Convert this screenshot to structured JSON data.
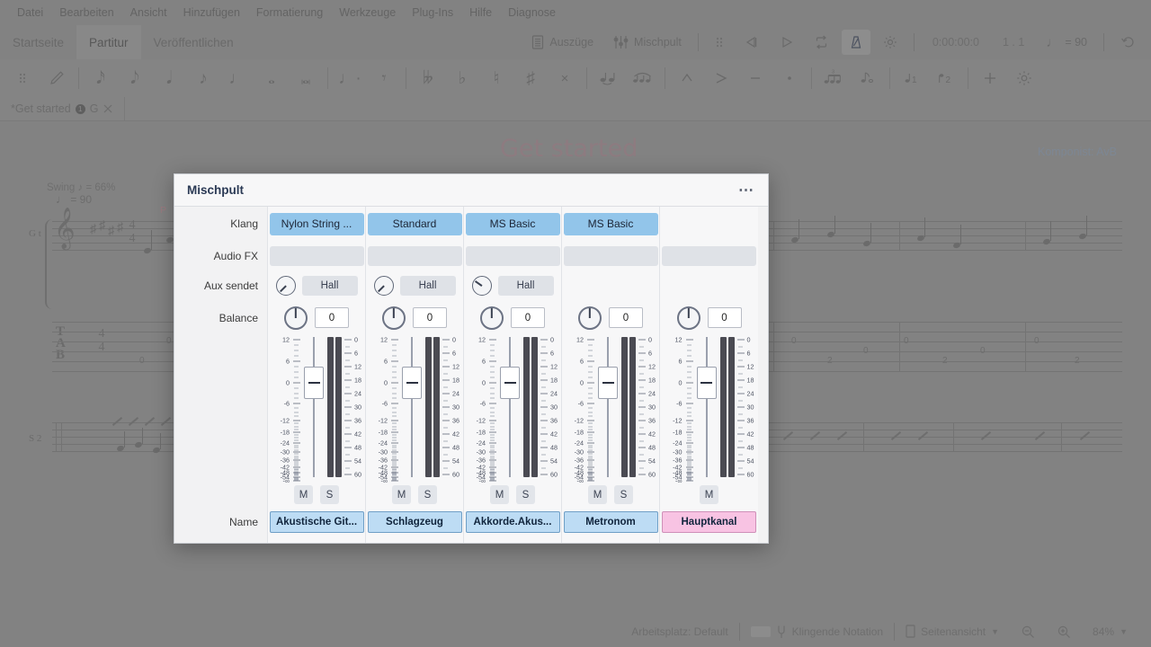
{
  "menubar": {
    "items": [
      "Datei",
      "Bearbeiten",
      "Ansicht",
      "Hinzufügen",
      "Formatierung",
      "Werkzeuge",
      "Plug-Ins",
      "Hilfe",
      "Diagnose"
    ]
  },
  "ribbon": {
    "tabs": [
      {
        "label": "Startseite",
        "active": false
      },
      {
        "label": "Partitur",
        "active": true
      },
      {
        "label": "Veröffentlichen",
        "active": false
      }
    ],
    "parts_button": "Auszüge",
    "mixer_button": "Mischpult",
    "transport": {
      "grip_icon": "drag-grip-icon",
      "rewind_icon": "rewind-icon",
      "play_icon": "play-icon",
      "loop_icon": "loop-icon",
      "metronome_icon": "metronome-icon",
      "metronome_active": true,
      "settings_icon": "gear-icon",
      "timecode": "0:00:00:0",
      "position": "1 . 1",
      "tempo": "= 90",
      "tempo_note_icon": "quarter-note-icon",
      "undo_icon": "undo-icon"
    }
  },
  "notation_toolbar": {
    "grip_icon": "drag-grip-icon",
    "groups": [
      [
        "pencil-icon"
      ],
      [
        "note-32nd-icon",
        "note-32nd-b-icon",
        "note-16th-icon",
        "note-8th-icon",
        "note-quarter-icon",
        "note-half-icon",
        "note-whole-icon"
      ],
      [
        "dotted-note-icon",
        "rest-icon"
      ],
      [
        "double-flat-icon",
        "flat-icon",
        "natural-icon",
        "sharp-icon",
        "double-sharp-icon"
      ],
      [
        "tie-icon",
        "slur-icon"
      ],
      [
        "marcato-icon",
        "accent-icon",
        "tenuto-icon",
        "staccato-icon"
      ],
      [
        "triplet-icon",
        "grace-note-icon"
      ],
      [
        "voice-1-icon",
        "voice-2-icon"
      ],
      [
        "add-icon",
        "gear-icon"
      ]
    ]
  },
  "document_tab": {
    "title": "*Get started",
    "badge": "1",
    "key": "G",
    "close_icon": "close-icon"
  },
  "score": {
    "title": "Get started",
    "composer": "Komponist: AvB",
    "swing_text": "Swing ♪ = 66%",
    "tempo_text": "= 90",
    "time_signature_top": "4",
    "time_signature_bottom": "4",
    "tab_letters": [
      "T",
      "A",
      "B"
    ],
    "system_labels": [
      "G t",
      "S 2"
    ]
  },
  "dialog": {
    "title": "Mischpult",
    "overflow_icon": "more-options-icon",
    "row_labels": {
      "klang": "Klang",
      "audio_fx": "Audio FX",
      "aux_send": "Aux sendet",
      "balance": "Balance",
      "name": "Name"
    },
    "mute_label": "M",
    "solo_label": "S",
    "fader_scale_left": [
      "12",
      "6",
      "0",
      "-6",
      "-12",
      "-18",
      "-24",
      "-30",
      "-36",
      "-42",
      "-48",
      "-54",
      "-∞"
    ],
    "meter_scale_right": [
      "0",
      "6",
      "12",
      "18",
      "24",
      "30",
      "36",
      "42",
      "48",
      "54",
      "60"
    ],
    "channels": [
      {
        "name": "Akustische Git...",
        "sound": "Nylon String ...",
        "audio_fx": "",
        "aux_send_label": "Hall",
        "aux_knob_angle": 225,
        "has_aux": true,
        "balance": "0",
        "balance_knob_angle": 0,
        "fader_db": "0",
        "has_solo": true,
        "is_master": false
      },
      {
        "name": "Schlagzeug",
        "sound": "Standard",
        "audio_fx": "",
        "aux_send_label": "Hall",
        "aux_knob_angle": 225,
        "has_aux": true,
        "balance": "0",
        "balance_knob_angle": 0,
        "fader_db": "0",
        "has_solo": true,
        "is_master": false
      },
      {
        "name": "Akkorde.Akus...",
        "sound": "MS Basic",
        "audio_fx": "",
        "aux_send_label": "Hall",
        "aux_knob_angle": 305,
        "has_aux": true,
        "balance": "0",
        "balance_knob_angle": 0,
        "fader_db": "0",
        "has_solo": true,
        "is_master": false
      },
      {
        "name": "Metronom",
        "sound": "MS Basic",
        "audio_fx": "",
        "aux_send_label": "",
        "aux_knob_angle": 0,
        "has_aux": false,
        "balance": "0",
        "balance_knob_angle": 0,
        "fader_db": "0",
        "has_solo": true,
        "is_master": false
      },
      {
        "name": "Hauptkanal",
        "sound": "",
        "audio_fx": "",
        "aux_send_label": "",
        "aux_knob_angle": 0,
        "has_aux": false,
        "balance": "0",
        "balance_knob_angle": 0,
        "fader_db": "0",
        "has_solo": false,
        "is_master": true
      }
    ]
  },
  "statusbar": {
    "workspace": "Arbeitsplatz: Default",
    "concert_pitch": "Klingende Notation",
    "concert_pitch_icon": "tuning-fork-icon",
    "view_mode": "Seitenansicht",
    "view_mode_icon": "page-icon",
    "zoom_out_icon": "zoom-out-icon",
    "zoom_in_icon": "zoom-in-icon",
    "zoom_level": "84%",
    "chevron_icon": "chevron-down-icon"
  },
  "colors": {
    "klang_button": "#92c5ea",
    "channel_name": "#bddcf4",
    "master_name": "#f8c3e3",
    "app_chrome": "#828282"
  }
}
